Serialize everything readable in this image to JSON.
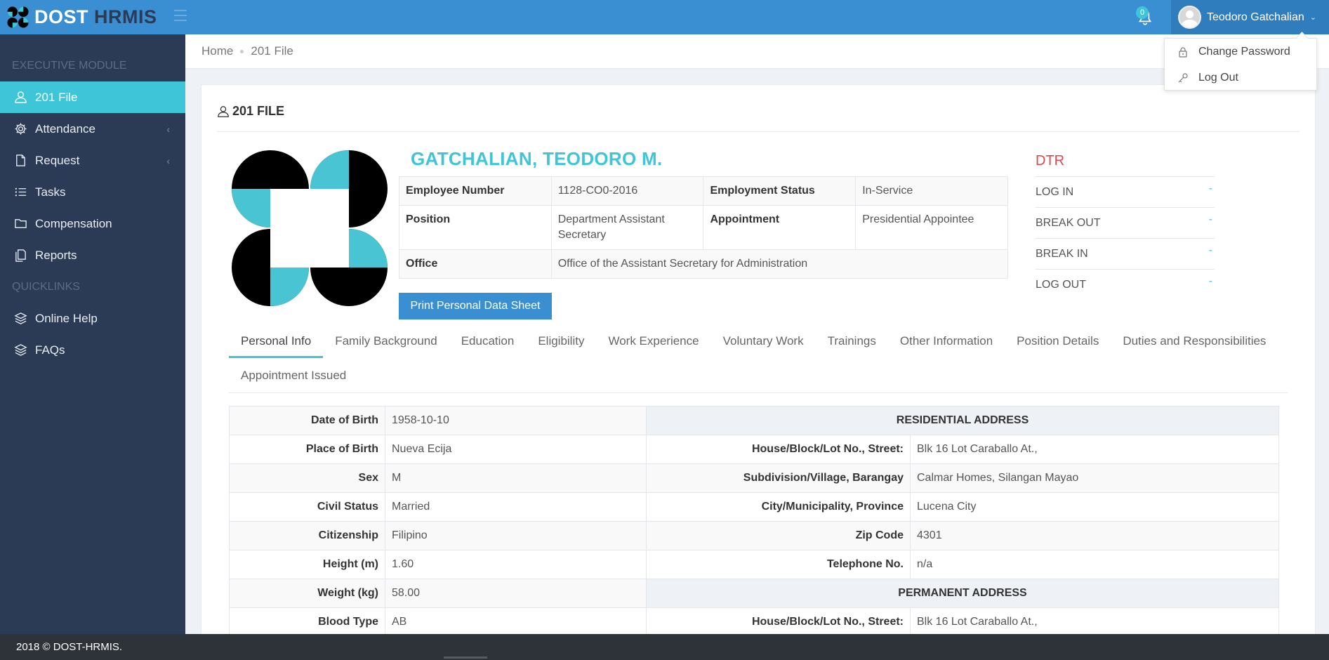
{
  "brand": {
    "name_a": "DOST",
    "name_b": "HRMIS"
  },
  "topbar": {
    "notifications_count": "0",
    "user_name": "Teodoro Gatchalian"
  },
  "user_dropdown": {
    "items": [
      {
        "label": "Change Password",
        "icon": "lock-icon"
      },
      {
        "label": "Log Out",
        "icon": "key-icon"
      }
    ]
  },
  "sidebar": {
    "section_executive": "EXECUTIVE MODULE",
    "section_quicklinks": "QUICKLINKS",
    "items": [
      {
        "label": "201 File",
        "icon": "user-icon",
        "active": true
      },
      {
        "label": "Attendance",
        "icon": "gear-icon",
        "has_submenu": true
      },
      {
        "label": "Request",
        "icon": "document-icon",
        "has_submenu": true
      },
      {
        "label": "Tasks",
        "icon": "list-icon"
      },
      {
        "label": "Compensation",
        "icon": "folder-icon"
      },
      {
        "label": "Reports",
        "icon": "reports-icon"
      }
    ],
    "quicklinks": [
      {
        "label": "Online Help",
        "icon": "layers-icon"
      },
      {
        "label": "FAQs",
        "icon": "layers-icon"
      }
    ]
  },
  "breadcrumb": {
    "home": "Home",
    "current": "201 File"
  },
  "panel": {
    "title": "201 FILE"
  },
  "employee": {
    "name": "GATCHALIAN, TEODORO M.",
    "employee_number_label": "Employee Number",
    "employee_number": "1128-CO0-2016",
    "employment_status_label": "Employment Status",
    "employment_status": "In-Service",
    "position_label": "Position",
    "position": "Department Assistant Secretary",
    "appointment_label": "Appointment",
    "appointment": "Presidential Appointee",
    "office_label": "Office",
    "office": "Office of the Assistant Secretary for Administration",
    "print_button": "Print Personal Data Sheet"
  },
  "dtr": {
    "title": "DTR",
    "rows": [
      {
        "label": "LOG IN",
        "value": "-"
      },
      {
        "label": "BREAK OUT",
        "value": "-"
      },
      {
        "label": "BREAK IN",
        "value": "-"
      },
      {
        "label": "LOG OUT",
        "value": "-"
      }
    ]
  },
  "tabs": [
    "Personal Info",
    "Family Background",
    "Education",
    "Eligibility",
    "Work Experience",
    "Voluntary Work",
    "Trainings",
    "Other Information",
    "Position Details",
    "Duties and Responsibilities",
    "Appointment Issued"
  ],
  "personal_info": {
    "rows": [
      {
        "label": "Date of Birth",
        "value": "1958-10-10"
      },
      {
        "label": "Place of Birth",
        "value": "Nueva Ecija"
      },
      {
        "label": "Sex",
        "value": "M"
      },
      {
        "label": "Civil Status",
        "value": "Married"
      },
      {
        "label": "Citizenship",
        "value": "Filipino"
      },
      {
        "label": "Height (m)",
        "value": "1.60"
      },
      {
        "label": "Weight (kg)",
        "value": "58.00"
      },
      {
        "label": "Blood Type",
        "value": "AB"
      }
    ],
    "residential_header": "RESIDENTIAL ADDRESS",
    "residential": [
      {
        "label": "House/Block/Lot No., Street:",
        "value": "Blk 16 Lot Caraballo At.,"
      },
      {
        "label": "Subdivision/Village, Barangay",
        "value": "Calmar Homes, Silangan Mayao"
      },
      {
        "label": "City/Municipality, Province",
        "value": "Lucena City"
      },
      {
        "label": "Zip Code",
        "value": "4301"
      },
      {
        "label": "Telephone No.",
        "value": "n/a"
      }
    ],
    "permanent_header": "PERMANENT ADDRESS",
    "permanent": [
      {
        "label": "House/Block/Lot No., Street:",
        "value": "Blk 16 Lot Caraballo At.,"
      }
    ]
  },
  "footer": {
    "text": "2018 © DOST-HRMIS."
  },
  "colors": {
    "topbar": "#3a8fd3",
    "sidebar": "#2b3a55",
    "accent": "#3ec6d8",
    "dtr_title": "#e0464e"
  }
}
